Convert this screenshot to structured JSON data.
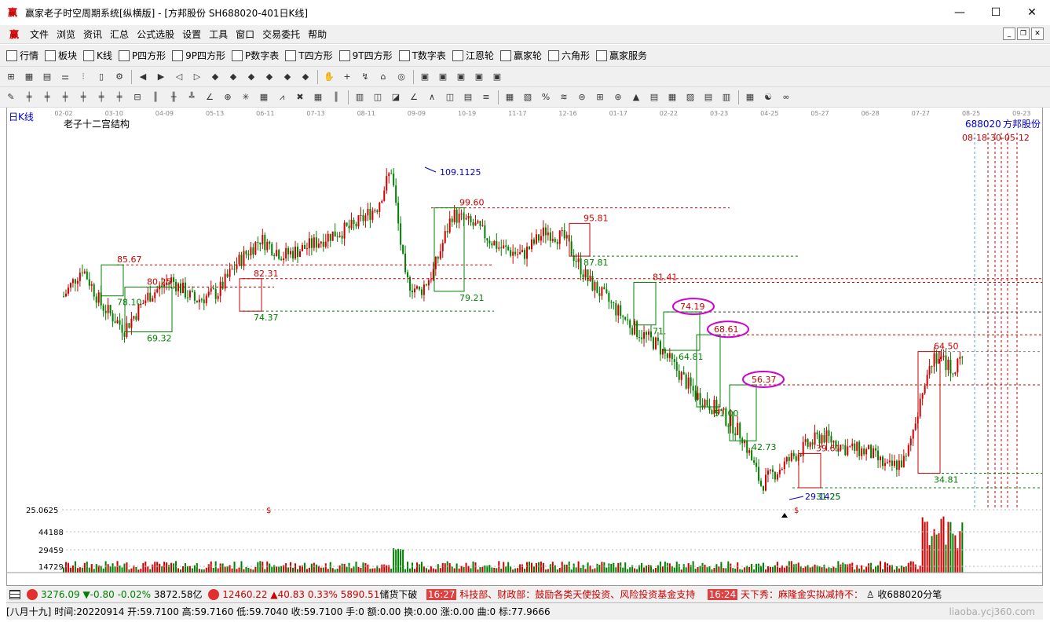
{
  "window": {
    "title": "赢家老子时空周期系统[纵横版] - [方邦股份   SH688020-401日K线]",
    "app_glyph": "赢",
    "buttons": {
      "minimize": "—",
      "maximize": "☐",
      "close": "✕"
    }
  },
  "menu": [
    "文件",
    "浏览",
    "资讯",
    "汇总",
    "公式选股",
    "设置",
    "工具",
    "窗口",
    "交易委托",
    "帮助"
  ],
  "toolbar1": [
    {
      "icon": "table-icon",
      "label": "行情"
    },
    {
      "icon": "blocks-icon",
      "label": "板块"
    },
    {
      "icon": "candlestick-icon",
      "label": "K线"
    },
    {
      "icon": "p-square-icon",
      "label": "P四方形"
    },
    {
      "icon": "9p-square-icon",
      "label": "9P四方形"
    },
    {
      "icon": "p-number-icon",
      "label": "P数字表"
    },
    {
      "icon": "t-square-icon",
      "label": "T四方形"
    },
    {
      "icon": "9t-square-icon",
      "label": "9T四方形"
    },
    {
      "icon": "t-number-icon",
      "label": "T数字表"
    },
    {
      "icon": "wheel-icon",
      "label": "江恩轮"
    },
    {
      "icon": "winner-wheel-icon",
      "label": "赢家轮"
    },
    {
      "icon": "hexagon-icon",
      "label": "六角形"
    },
    {
      "icon": "dollar-icon",
      "label": "赢家服务"
    }
  ],
  "chart_header": {
    "period": "日K线",
    "indicator": "老子十二宫结构",
    "code": "688020",
    "name": "方邦股份",
    "cycle_labels": "08-18-30-05-12"
  },
  "chart_data": {
    "type": "candlestick",
    "date_axis": [
      "02-02",
      "03-10",
      "04-09",
      "05-13",
      "06-11",
      "07-13",
      "08-11",
      "09-09",
      "10-19",
      "11-17",
      "12-16",
      "01-17",
      "02-22",
      "03-23",
      "04-25",
      "05-27",
      "06-28",
      "07-27",
      "08-25",
      "09-23"
    ],
    "price_labels_red": [
      "85.67",
      "80.25",
      "82.31",
      "99.60",
      "95.81",
      "81.41",
      "74.19",
      "68.61",
      "56.37",
      "39.61",
      "64.50"
    ],
    "price_labels_green": [
      "78.10",
      "69.32",
      "74.37",
      "79.21",
      "87.81",
      "71.",
      "64.81",
      "51.00",
      "42.73",
      "34.81"
    ],
    "high_label": "109.1125",
    "low_label": "29.1425",
    "low_label2": "31.25",
    "circled_levels": [
      "74.19",
      "68.61",
      "56.37"
    ],
    "price_scale_label": "25.0625",
    "volume_axis": [
      "44188",
      "29459",
      "14729"
    ],
    "marker": "$"
  },
  "status": {
    "sh_index": "3276.09",
    "sh_change": "▼-0.80",
    "sh_pct": "-0.02%",
    "sh_amount": "3872.58亿",
    "sz_index": "12460.22",
    "sz_change": "▲40.83",
    "sz_pct": "0.33%",
    "sz_amount": "5890.51",
    "news1": "储货下破",
    "time1": "16:27",
    "news2": "科技部、财政部：鼓励各类天使投资、风险投资基金支持",
    "time2": "16:24",
    "news3": "天下秀：麻隆金实拟减持不：",
    "tail": "收688020分笔"
  },
  "info": {
    "lunar": "[八月十九]",
    "time": "时间:20220914",
    "open": "开:59.7100",
    "high": "高:59.7160",
    "low": "低:59.7040",
    "close": "收:59.7100",
    "hand": "手:0",
    "amount": "额:0.00",
    "turnover": "换:0.00",
    "change": "涨:0.00",
    "qu": "曲:0",
    "biao": "标:77.9666"
  },
  "watermark": "liaoba.ycj360.com"
}
